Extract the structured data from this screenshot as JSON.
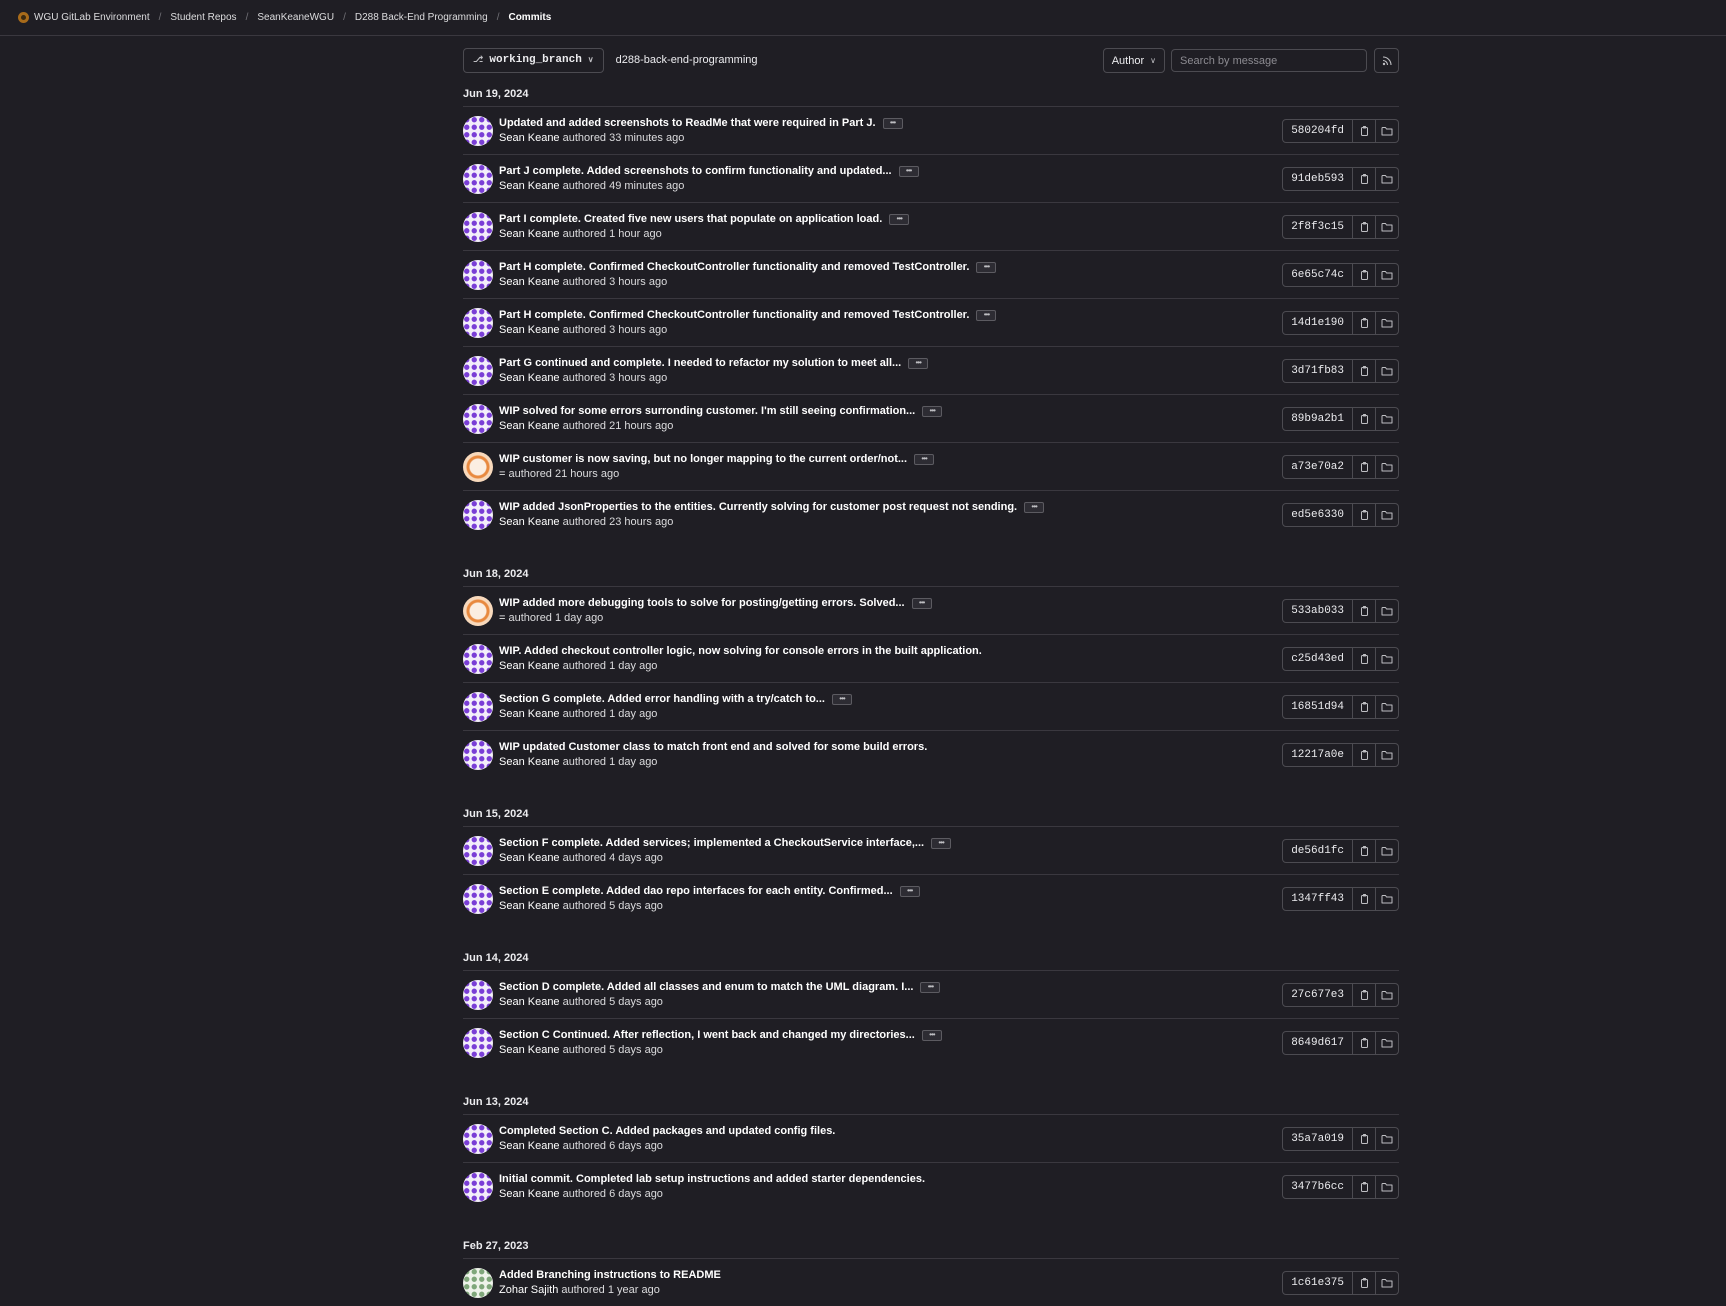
{
  "breadcrumb": [
    "WGU GitLab Environment",
    "Student Repos",
    "SeanKeaneWGU",
    "D288 Back-End Programming",
    "Commits"
  ],
  "controls": {
    "branch": "working_branch",
    "repo": "d288-back-end-programming",
    "author_label": "Author",
    "search_placeholder": "Search by message"
  },
  "days": [
    {
      "date": "Jun 19, 2024",
      "commits": [
        {
          "message": "Updated and added screenshots to ReadMe that were required in Part J.",
          "author": "Sean Keane",
          "suffix": "authored 33 minutes ago",
          "sha": "580204fd",
          "avatar": "sean",
          "more": true
        },
        {
          "message": "Part J complete. Added screenshots to confirm functionality and updated...",
          "author": "Sean Keane",
          "suffix": "authored 49 minutes ago",
          "sha": "91deb593",
          "avatar": "sean",
          "more": true
        },
        {
          "message": "Part I complete. Created five new users that populate on application load.",
          "author": "Sean Keane",
          "suffix": "authored 1 hour ago",
          "sha": "2f8f3c15",
          "avatar": "sean",
          "more": true
        },
        {
          "message": "Part H complete. Confirmed CheckoutController functionality and removed TestController.",
          "author": "Sean Keane",
          "suffix": "authored 3 hours ago",
          "sha": "6e65c74c",
          "avatar": "sean",
          "more": true
        },
        {
          "message": "Part H complete. Confirmed CheckoutController functionality and removed TestController.",
          "author": "Sean Keane",
          "suffix": "authored 3 hours ago",
          "sha": "14d1e190",
          "avatar": "sean",
          "more": true
        },
        {
          "message": "Part G continued and complete. I needed to refactor my solution to meet all...",
          "author": "Sean Keane",
          "suffix": "authored 3 hours ago",
          "sha": "3d71fb83",
          "avatar": "sean",
          "more": true
        },
        {
          "message": "WIP solved for some errors surronding customer. I'm still seeing confirmation...",
          "author": "Sean Keane",
          "suffix": "authored 21 hours ago",
          "sha": "89b9a2b1",
          "avatar": "sean",
          "more": true
        },
        {
          "message": "WIP customer is now saving, but no longer mapping to the current order/not...",
          "author": "=",
          "suffix": "authored 21 hours ago",
          "sha": "a73e70a2",
          "avatar": "empty",
          "more": true
        },
        {
          "message": "WIP added JsonProperties to the entities. Currently solving for customer post request not sending.",
          "author": "Sean Keane",
          "suffix": "authored 23 hours ago",
          "sha": "ed5e6330",
          "avatar": "sean",
          "more": true
        }
      ]
    },
    {
      "date": "Jun 18, 2024",
      "commits": [
        {
          "message": "WIP added more debugging tools to solve for posting/getting errors. Solved...",
          "author": "=",
          "suffix": "authored 1 day ago",
          "sha": "533ab033",
          "avatar": "empty",
          "more": true
        },
        {
          "message": "WIP. Added checkout controller logic, now solving for console errors in the built application.",
          "author": "Sean Keane",
          "suffix": "authored 1 day ago",
          "sha": "c25d43ed",
          "avatar": "sean",
          "more": false
        },
        {
          "message": "Section G complete. Added error handling with a try/catch to...",
          "author": "Sean Keane",
          "suffix": "authored 1 day ago",
          "sha": "16851d94",
          "avatar": "sean",
          "more": true
        },
        {
          "message": "WIP updated Customer class to match front end and solved for some build errors.",
          "author": "Sean Keane",
          "suffix": "authored 1 day ago",
          "sha": "12217a0e",
          "avatar": "sean",
          "more": false
        }
      ]
    },
    {
      "date": "Jun 15, 2024",
      "commits": [
        {
          "message": "Section F complete. Added services; implemented a CheckoutService interface,...",
          "author": "Sean Keane",
          "suffix": "authored 4 days ago",
          "sha": "de56d1fc",
          "avatar": "sean",
          "more": true
        },
        {
          "message": "Section E complete. Added dao repo interfaces for each entity. Confirmed...",
          "author": "Sean Keane",
          "suffix": "authored 5 days ago",
          "sha": "1347ff43",
          "avatar": "sean",
          "more": true
        }
      ]
    },
    {
      "date": "Jun 14, 2024",
      "commits": [
        {
          "message": "Section D complete. Added all classes and enum to match the UML diagram. I...",
          "author": "Sean Keane",
          "suffix": "authored 5 days ago",
          "sha": "27c677e3",
          "avatar": "sean",
          "more": true
        },
        {
          "message": "Section C Continued. After reflection, I went back and changed my directories...",
          "author": "Sean Keane",
          "suffix": "authored 5 days ago",
          "sha": "8649d617",
          "avatar": "sean",
          "more": true
        }
      ]
    },
    {
      "date": "Jun 13, 2024",
      "commits": [
        {
          "message": "Completed Section C. Added packages and updated config files.",
          "author": "Sean Keane",
          "suffix": "authored 6 days ago",
          "sha": "35a7a019",
          "avatar": "sean",
          "more": false
        },
        {
          "message": "Initial commit. Completed lab setup instructions and added starter dependencies.",
          "author": "Sean Keane",
          "suffix": "authored 6 days ago",
          "sha": "3477b6cc",
          "avatar": "sean",
          "more": false
        }
      ]
    },
    {
      "date": "Feb 27, 2023",
      "commits": [
        {
          "message": "Added Branching instructions to README",
          "author": "Zohar Sajith",
          "suffix": "authored 1 year ago",
          "sha": "1c61e375",
          "avatar": "zohar",
          "more": false
        }
      ]
    }
  ]
}
